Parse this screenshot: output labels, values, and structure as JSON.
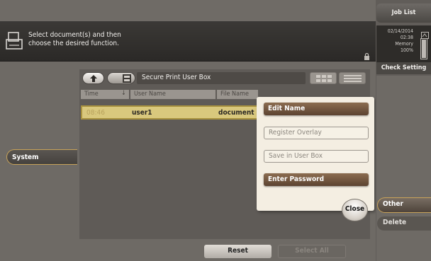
{
  "header": {
    "message_line1": "Select document(s) and then",
    "message_line2": "choose the desired function."
  },
  "right_panel": {
    "job_list": "Job List",
    "date": "02/14/2014",
    "time": "02:38",
    "memory_label": "Memory",
    "memory_value": "100%",
    "memory_level": 1.0,
    "check_setting": "Check Setting",
    "other": "Other",
    "delete": "Delete"
  },
  "sidebar": {
    "active_tab": "System"
  },
  "box": {
    "title": "Secure Print User Box",
    "columns": [
      "Time",
      "User Name",
      "File Name"
    ],
    "rows": [
      {
        "time": "08:46",
        "user": "user1",
        "file": "document"
      }
    ]
  },
  "popup": {
    "items": [
      {
        "label": "Edit Name",
        "state": "enabled"
      },
      {
        "label": "Register Overlay",
        "state": "disabled"
      },
      {
        "label": "Save in User Box",
        "state": "disabled"
      },
      {
        "label": "Enter Password",
        "state": "enabled"
      }
    ],
    "close": "Close"
  },
  "footer": {
    "reset": "Reset",
    "select_all": "Select All"
  },
  "colors": {
    "accent_border": "#c8a35a",
    "row_highlight": "#d9c87d",
    "popup_bg": "#f4eee2",
    "popup_active_btn": "#5c4331"
  }
}
